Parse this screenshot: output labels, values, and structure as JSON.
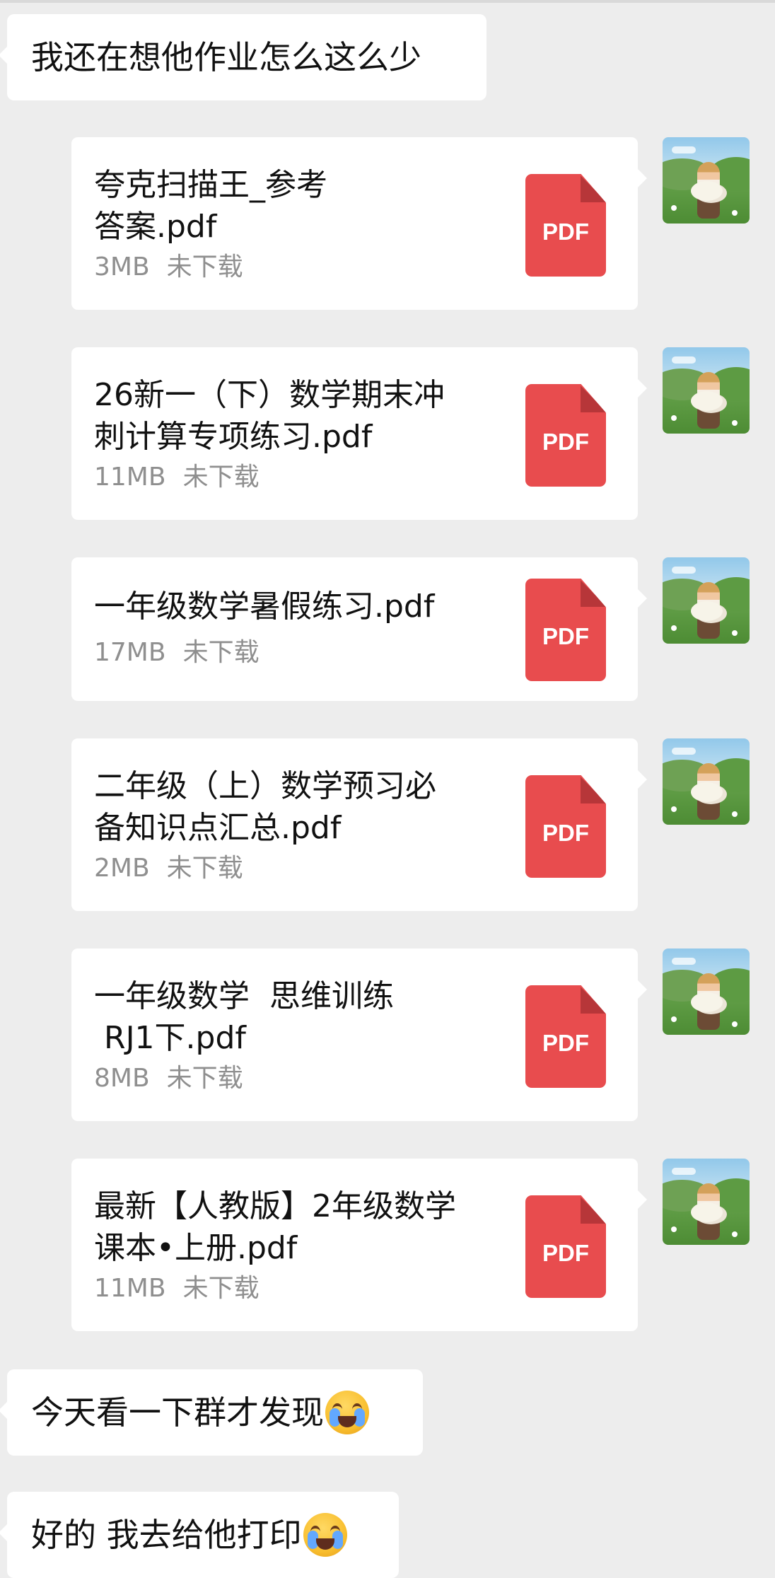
{
  "messages": [
    {
      "type": "text",
      "text": "我还在想他作业怎么这么少"
    },
    {
      "type": "file",
      "name": "夸克扫描王_参考\n答案.pdf",
      "size": "3MB",
      "status": "未下载",
      "icon": "PDF"
    },
    {
      "type": "file",
      "name": "26新一（下）数学期末冲\n刺计算专项练习.pdf",
      "size": "11MB",
      "status": "未下载",
      "icon": "PDF"
    },
    {
      "type": "file",
      "name": "一年级数学暑假练习.pdf",
      "size": "17MB",
      "status": "未下载",
      "icon": "PDF"
    },
    {
      "type": "file",
      "name": "二年级（上）数学预习必\n备知识点汇总.pdf",
      "size": "2MB",
      "status": "未下载",
      "icon": "PDF"
    },
    {
      "type": "file",
      "name": "一年级数学  思维训练\n RJ1下.pdf",
      "size": "8MB",
      "status": "未下载",
      "icon": "PDF"
    },
    {
      "type": "file",
      "name": "最新【人教版】2年级数学\n课本•上册.pdf",
      "size": "11MB",
      "status": "未下载",
      "icon": "PDF"
    },
    {
      "type": "text",
      "text": "今天看一下群才发现",
      "emoji": "crying-face"
    },
    {
      "type": "text",
      "text": "好的 我去给他打印",
      "emoji": "crying-face"
    }
  ],
  "colors": {
    "background": "#ededed",
    "bubble": "#ffffff",
    "pdf": "#e84c4e",
    "meta": "#8f8f8f"
  }
}
